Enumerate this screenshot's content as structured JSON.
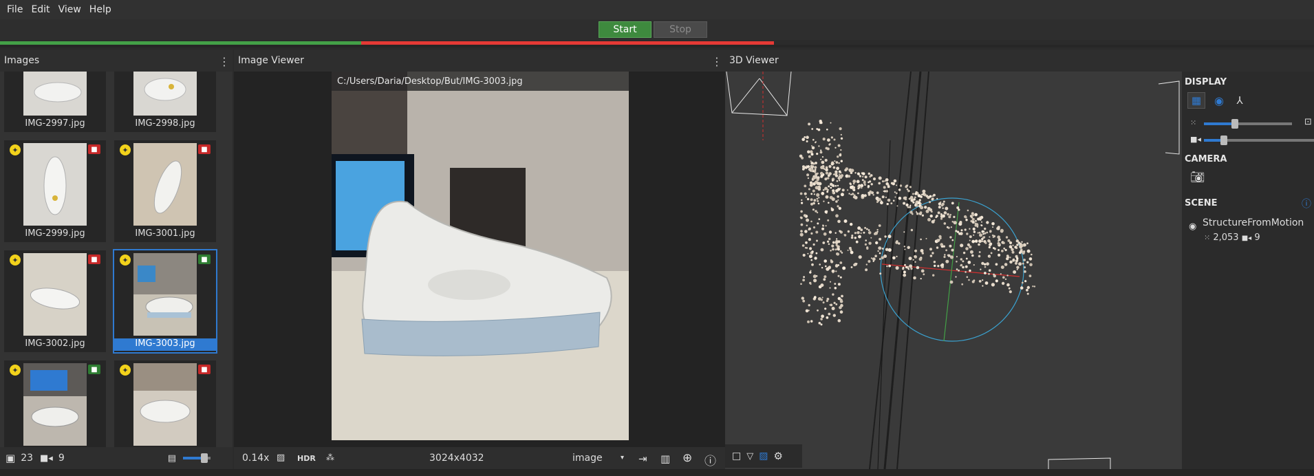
{
  "menu": [
    "File",
    "Edit",
    "View",
    "Help"
  ],
  "toolbar": {
    "start": "Start",
    "stop": "Stop"
  },
  "progress": {
    "green_fraction": 0.383,
    "red_fraction": 0.438
  },
  "images_panel": {
    "title": "Images",
    "thumbs": [
      {
        "name": "IMG-2997.jpg"
      },
      {
        "name": "IMG-2998.jpg"
      },
      {
        "name": "IMG-2999.jpg",
        "camera": "red"
      },
      {
        "name": "IMG-3001.jpg",
        "camera": "red"
      },
      {
        "name": "IMG-3002.jpg",
        "camera": "red"
      },
      {
        "name": "IMG-3003.jpg",
        "camera": "green",
        "selected": true
      },
      {
        "name": "",
        "camera": "green"
      },
      {
        "name": "",
        "camera": "red"
      }
    ],
    "footer": {
      "image_count": "23",
      "camera_count": "9"
    }
  },
  "image_viewer": {
    "title": "Image Viewer",
    "path": "C:/Users/Daria/Desktop/But/IMG-3003.jpg",
    "zoom": "0.14x",
    "hdr": "HDR",
    "resolution": "3024x4032",
    "mode": "image"
  },
  "viewer3d": {
    "title": "3D Viewer"
  },
  "side_panel": {
    "display": "DISPLAY",
    "camera": "CAMERA",
    "scene": "SCENE",
    "node": "StructureFromMotion",
    "points": "2,053",
    "cameras": "9"
  },
  "colors": {
    "accent": "#2f7ad1",
    "start_green": "#3e8a3e",
    "progress_green": "#43a047",
    "progress_red": "#e53935"
  }
}
